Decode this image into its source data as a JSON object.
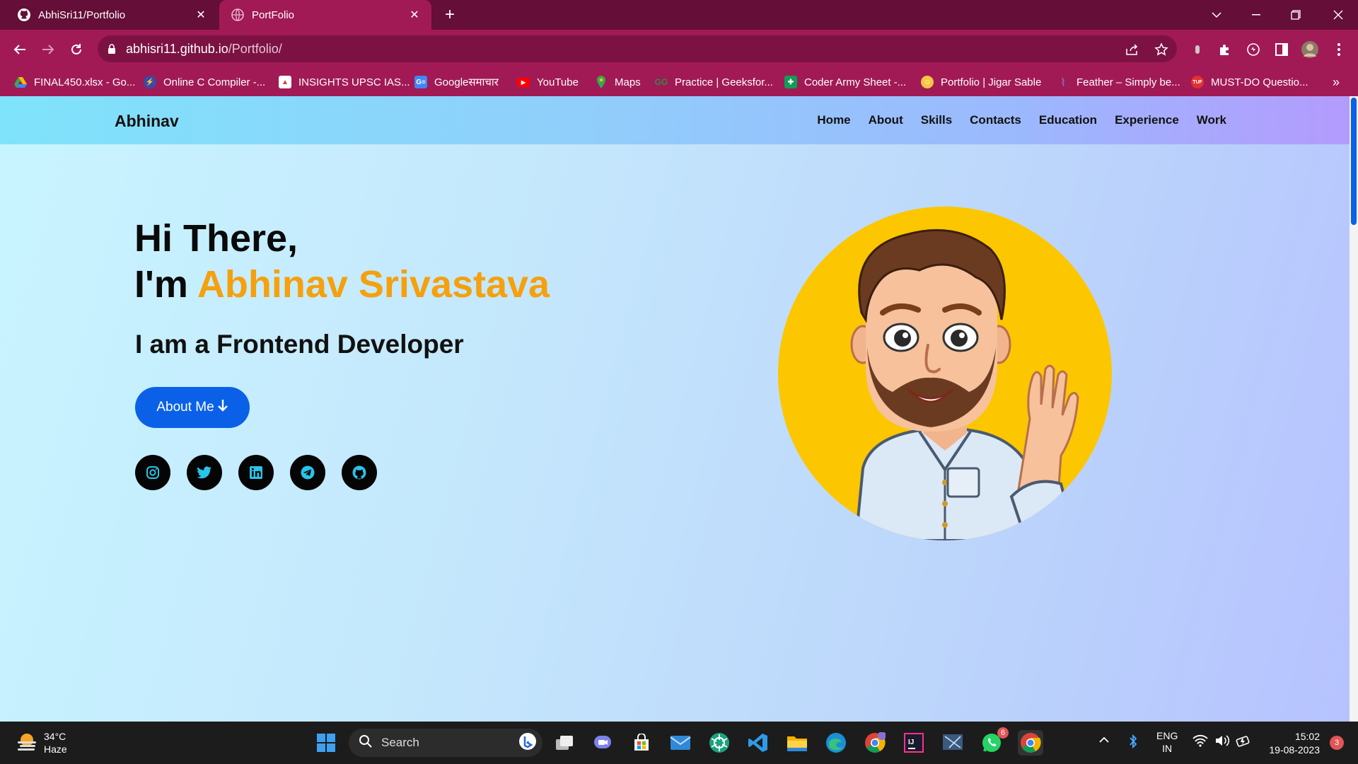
{
  "browser": {
    "tabs": [
      {
        "title": "AbhiSri11/Portfolio",
        "icon": "github-icon",
        "active": false
      },
      {
        "title": "PortFolio",
        "icon": "globe-icon",
        "active": true
      }
    ],
    "url_host": "abhisri11.github.io",
    "url_path": "/Portfolio/",
    "bookmarks": [
      {
        "label": "FINAL450.xlsx - Go...",
        "icon": "google-drive-icon",
        "color": "#2fa84f"
      },
      {
        "label": "Online C Compiler -...",
        "icon": "bolt-icon",
        "color": "#4257b2"
      },
      {
        "label": "INSIGHTS UPSC IAS...",
        "icon": "insights-icon",
        "color": "#d43b2c"
      },
      {
        "label": "Googleसमाचार",
        "icon": "google-news-icon",
        "color": "#4285f4"
      },
      {
        "label": "YouTube",
        "icon": "youtube-icon",
        "color": "#ff0000"
      },
      {
        "label": "Maps",
        "icon": "maps-icon",
        "color": "#34a853"
      },
      {
        "label": "Practice | Geeksfor...",
        "icon": "gfg-icon",
        "color": "#2f8d46"
      },
      {
        "label": "Coder Army Sheet -...",
        "icon": "sheets-icon",
        "color": "#0f9d58"
      },
      {
        "label": "Portfolio | Jigar Sable",
        "icon": "avatar-icon",
        "color": "#f5c542"
      },
      {
        "label": "Feather – Simply be...",
        "icon": "feather-icon",
        "color": "#8a6fb5"
      },
      {
        "label": "MUST-DO Questio...",
        "icon": "tuf-icon",
        "color": "#e03131"
      }
    ]
  },
  "site": {
    "logo": "Abhinav",
    "menu": [
      "Home",
      "About",
      "Skills",
      "Contacts",
      "Education",
      "Experience",
      "Work"
    ],
    "hero": {
      "greeting": "Hi There,",
      "im": "I'm ",
      "name": "Abhinav Srivastava",
      "subtitle": "I am a Frontend Developer",
      "cta": "About Me"
    },
    "socials": [
      "instagram-icon",
      "twitter-icon",
      "linkedin-icon",
      "telegram-icon",
      "github-icon"
    ],
    "accent": "#f5a00d",
    "button_color": "#0a61e8"
  },
  "taskbar": {
    "temperature": "34°C",
    "weather": "Haze",
    "search_placeholder": "Search",
    "whatsapp_badge": "6",
    "lang_1": "ENG",
    "lang_2": "IN",
    "time": "15:02",
    "date": "19-08-2023",
    "notifications": "3"
  }
}
